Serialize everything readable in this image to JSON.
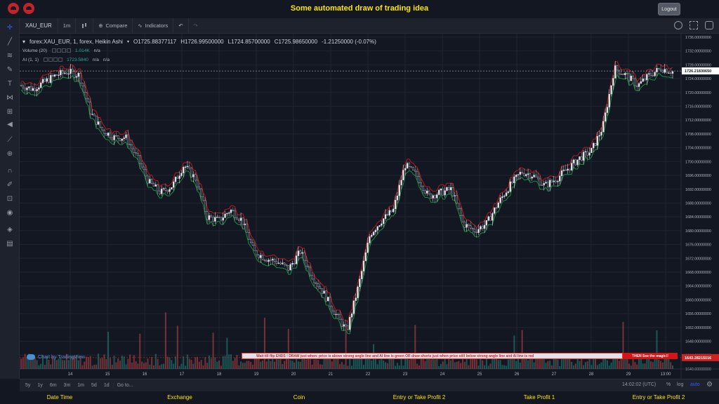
{
  "header": {
    "title": "Some automated draw of trading idea",
    "logout_label": "Logout"
  },
  "toolbar": {
    "symbol": "XAU_EUR",
    "interval": "1m",
    "compare_label": "Compare",
    "indicators_label": "Indicators"
  },
  "legend": {
    "series_title": "forex:XAU_EUR, 1, forex, Heikin Ashi",
    "open": "O1725.88377117",
    "high": "H1726.99500000",
    "low": "L1724.85700000",
    "close": "C1725.98650000",
    "change": "-1.21250000 (-0.07%)",
    "volume_label": "Volume (20)",
    "volume_value": "1.014K",
    "volume_na": "n/a",
    "ai_label": "AI (1, 1)",
    "ai_value": "1723.5840",
    "ai_na1": "n/a",
    "ai_na2": "n/a"
  },
  "chart_data": {
    "type": "candlestick",
    "chart_style": "Heikin Ashi",
    "y_range": [
      1640,
      1737
    ],
    "y_ticks": [
      "1736.00000000",
      "1732.00000000",
      "1728.00000000",
      "1724.00000000",
      "1720.00000000",
      "1716.00000000",
      "1712.00000000",
      "1708.00000000",
      "1704.00000000",
      "1700.00000000",
      "1696.00000000",
      "1692.00000000",
      "1688.00000000",
      "1684.00000000",
      "1680.00000000",
      "1676.00000000",
      "1672.00000000",
      "1668.00000000",
      "1664.00000000",
      "1660.00000000",
      "1656.00000000",
      "1652.00000000",
      "1648.00000000",
      "1644.00000000",
      "1640.00000000"
    ],
    "x_ticks": [
      "14",
      "15",
      "16",
      "17",
      "18",
      "19",
      "20",
      "21",
      "22",
      "23",
      "24",
      "25",
      "26",
      "27",
      "28",
      "29",
      "13:00"
    ],
    "current_price_label": "1726.21830650",
    "lower_price_label": "1643.28215016",
    "price_path": [
      [
        0,
        1722
      ],
      [
        2,
        1721
      ],
      [
        4,
        1723
      ],
      [
        6,
        1725
      ],
      [
        8,
        1726
      ],
      [
        10,
        1725
      ],
      [
        12,
        1714
      ],
      [
        14,
        1709
      ],
      [
        16,
        1707
      ],
      [
        18,
        1707
      ],
      [
        20,
        1701
      ],
      [
        22,
        1694
      ],
      [
        24,
        1691
      ],
      [
        26,
        1693
      ],
      [
        28,
        1699
      ],
      [
        30,
        1695
      ],
      [
        32,
        1684
      ],
      [
        34,
        1683
      ],
      [
        36,
        1686
      ],
      [
        38,
        1683
      ],
      [
        40,
        1674
      ],
      [
        42,
        1672
      ],
      [
        44,
        1671
      ],
      [
        46,
        1669
      ],
      [
        48,
        1674
      ],
      [
        50,
        1667
      ],
      [
        52,
        1662
      ],
      [
        54,
        1656
      ],
      [
        56,
        1651
      ],
      [
        58,
        1664
      ],
      [
        60,
        1679
      ],
      [
        62,
        1683
      ],
      [
        64,
        1686
      ],
      [
        66,
        1699
      ],
      [
        68,
        1696
      ],
      [
        70,
        1690
      ],
      [
        72,
        1691
      ],
      [
        74,
        1692
      ],
      [
        76,
        1682
      ],
      [
        78,
        1680
      ],
      [
        80,
        1682
      ],
      [
        82,
        1688
      ],
      [
        84,
        1693
      ],
      [
        86,
        1697
      ],
      [
        88,
        1696
      ],
      [
        90,
        1693
      ],
      [
        92,
        1695
      ],
      [
        94,
        1698
      ],
      [
        96,
        1701
      ],
      [
        98,
        1703
      ],
      [
        100,
        1710
      ],
      [
        102,
        1727
      ],
      [
        104,
        1725
      ],
      [
        106,
        1722
      ],
      [
        108,
        1725
      ],
      [
        110,
        1727
      ],
      [
        112,
        1726
      ]
    ]
  },
  "banner": {
    "text": "Wait till flip ENDS !    DRAW just when:  price is above strong angle line and AI line is green          OR          draw shorts just when price still below strong angle line and AI line is red",
    "cta": "THEN See the magic!!"
  },
  "watermark": "Chart by TradingView",
  "rangebar": {
    "ranges": [
      "5y",
      "1y",
      "6m",
      "3m",
      "1m",
      "5d",
      "1d"
    ],
    "goto": "Go to...",
    "time": "14:02:02 (UTC)",
    "pct": "%",
    "log": "log",
    "auto": "auto"
  },
  "footer": {
    "items": [
      "Date Time",
      "Exchange",
      "Coin",
      "Entry or Take Profit 2",
      "Take Profit 1",
      "Entry or Take Profit 2"
    ]
  }
}
